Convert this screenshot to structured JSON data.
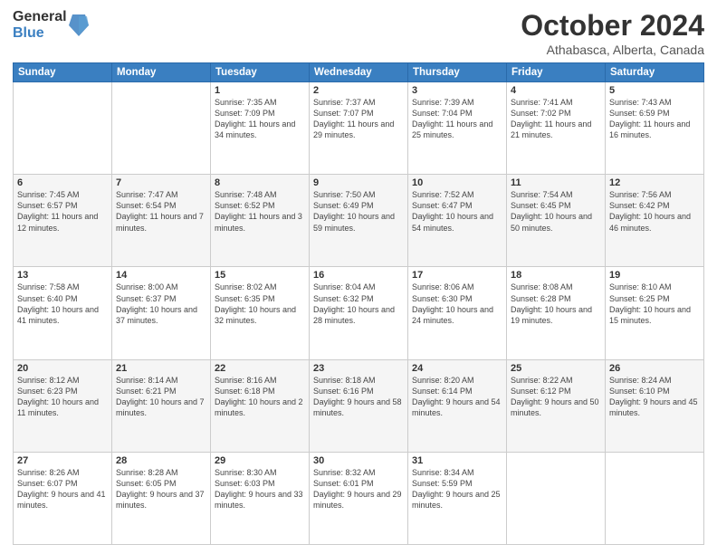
{
  "logo": {
    "general": "General",
    "blue": "Blue"
  },
  "title": "October 2024",
  "location": "Athabasca, Alberta, Canada",
  "weekdays": [
    "Sunday",
    "Monday",
    "Tuesday",
    "Wednesday",
    "Thursday",
    "Friday",
    "Saturday"
  ],
  "weeks": [
    [
      {
        "day": "",
        "sunrise": "",
        "sunset": "",
        "daylight": ""
      },
      {
        "day": "",
        "sunrise": "",
        "sunset": "",
        "daylight": ""
      },
      {
        "day": "1",
        "sunrise": "Sunrise: 7:35 AM",
        "sunset": "Sunset: 7:09 PM",
        "daylight": "Daylight: 11 hours and 34 minutes."
      },
      {
        "day": "2",
        "sunrise": "Sunrise: 7:37 AM",
        "sunset": "Sunset: 7:07 PM",
        "daylight": "Daylight: 11 hours and 29 minutes."
      },
      {
        "day": "3",
        "sunrise": "Sunrise: 7:39 AM",
        "sunset": "Sunset: 7:04 PM",
        "daylight": "Daylight: 11 hours and 25 minutes."
      },
      {
        "day": "4",
        "sunrise": "Sunrise: 7:41 AM",
        "sunset": "Sunset: 7:02 PM",
        "daylight": "Daylight: 11 hours and 21 minutes."
      },
      {
        "day": "5",
        "sunrise": "Sunrise: 7:43 AM",
        "sunset": "Sunset: 6:59 PM",
        "daylight": "Daylight: 11 hours and 16 minutes."
      }
    ],
    [
      {
        "day": "6",
        "sunrise": "Sunrise: 7:45 AM",
        "sunset": "Sunset: 6:57 PM",
        "daylight": "Daylight: 11 hours and 12 minutes."
      },
      {
        "day": "7",
        "sunrise": "Sunrise: 7:47 AM",
        "sunset": "Sunset: 6:54 PM",
        "daylight": "Daylight: 11 hours and 7 minutes."
      },
      {
        "day": "8",
        "sunrise": "Sunrise: 7:48 AM",
        "sunset": "Sunset: 6:52 PM",
        "daylight": "Daylight: 11 hours and 3 minutes."
      },
      {
        "day": "9",
        "sunrise": "Sunrise: 7:50 AM",
        "sunset": "Sunset: 6:49 PM",
        "daylight": "Daylight: 10 hours and 59 minutes."
      },
      {
        "day": "10",
        "sunrise": "Sunrise: 7:52 AM",
        "sunset": "Sunset: 6:47 PM",
        "daylight": "Daylight: 10 hours and 54 minutes."
      },
      {
        "day": "11",
        "sunrise": "Sunrise: 7:54 AM",
        "sunset": "Sunset: 6:45 PM",
        "daylight": "Daylight: 10 hours and 50 minutes."
      },
      {
        "day": "12",
        "sunrise": "Sunrise: 7:56 AM",
        "sunset": "Sunset: 6:42 PM",
        "daylight": "Daylight: 10 hours and 46 minutes."
      }
    ],
    [
      {
        "day": "13",
        "sunrise": "Sunrise: 7:58 AM",
        "sunset": "Sunset: 6:40 PM",
        "daylight": "Daylight: 10 hours and 41 minutes."
      },
      {
        "day": "14",
        "sunrise": "Sunrise: 8:00 AM",
        "sunset": "Sunset: 6:37 PM",
        "daylight": "Daylight: 10 hours and 37 minutes."
      },
      {
        "day": "15",
        "sunrise": "Sunrise: 8:02 AM",
        "sunset": "Sunset: 6:35 PM",
        "daylight": "Daylight: 10 hours and 32 minutes."
      },
      {
        "day": "16",
        "sunrise": "Sunrise: 8:04 AM",
        "sunset": "Sunset: 6:32 PM",
        "daylight": "Daylight: 10 hours and 28 minutes."
      },
      {
        "day": "17",
        "sunrise": "Sunrise: 8:06 AM",
        "sunset": "Sunset: 6:30 PM",
        "daylight": "Daylight: 10 hours and 24 minutes."
      },
      {
        "day": "18",
        "sunrise": "Sunrise: 8:08 AM",
        "sunset": "Sunset: 6:28 PM",
        "daylight": "Daylight: 10 hours and 19 minutes."
      },
      {
        "day": "19",
        "sunrise": "Sunrise: 8:10 AM",
        "sunset": "Sunset: 6:25 PM",
        "daylight": "Daylight: 10 hours and 15 minutes."
      }
    ],
    [
      {
        "day": "20",
        "sunrise": "Sunrise: 8:12 AM",
        "sunset": "Sunset: 6:23 PM",
        "daylight": "Daylight: 10 hours and 11 minutes."
      },
      {
        "day": "21",
        "sunrise": "Sunrise: 8:14 AM",
        "sunset": "Sunset: 6:21 PM",
        "daylight": "Daylight: 10 hours and 7 minutes."
      },
      {
        "day": "22",
        "sunrise": "Sunrise: 8:16 AM",
        "sunset": "Sunset: 6:18 PM",
        "daylight": "Daylight: 10 hours and 2 minutes."
      },
      {
        "day": "23",
        "sunrise": "Sunrise: 8:18 AM",
        "sunset": "Sunset: 6:16 PM",
        "daylight": "Daylight: 9 hours and 58 minutes."
      },
      {
        "day": "24",
        "sunrise": "Sunrise: 8:20 AM",
        "sunset": "Sunset: 6:14 PM",
        "daylight": "Daylight: 9 hours and 54 minutes."
      },
      {
        "day": "25",
        "sunrise": "Sunrise: 8:22 AM",
        "sunset": "Sunset: 6:12 PM",
        "daylight": "Daylight: 9 hours and 50 minutes."
      },
      {
        "day": "26",
        "sunrise": "Sunrise: 8:24 AM",
        "sunset": "Sunset: 6:10 PM",
        "daylight": "Daylight: 9 hours and 45 minutes."
      }
    ],
    [
      {
        "day": "27",
        "sunrise": "Sunrise: 8:26 AM",
        "sunset": "Sunset: 6:07 PM",
        "daylight": "Daylight: 9 hours and 41 minutes."
      },
      {
        "day": "28",
        "sunrise": "Sunrise: 8:28 AM",
        "sunset": "Sunset: 6:05 PM",
        "daylight": "Daylight: 9 hours and 37 minutes."
      },
      {
        "day": "29",
        "sunrise": "Sunrise: 8:30 AM",
        "sunset": "Sunset: 6:03 PM",
        "daylight": "Daylight: 9 hours and 33 minutes."
      },
      {
        "day": "30",
        "sunrise": "Sunrise: 8:32 AM",
        "sunset": "Sunset: 6:01 PM",
        "daylight": "Daylight: 9 hours and 29 minutes."
      },
      {
        "day": "31",
        "sunrise": "Sunrise: 8:34 AM",
        "sunset": "Sunset: 5:59 PM",
        "daylight": "Daylight: 9 hours and 25 minutes."
      },
      {
        "day": "",
        "sunrise": "",
        "sunset": "",
        "daylight": ""
      },
      {
        "day": "",
        "sunrise": "",
        "sunset": "",
        "daylight": ""
      }
    ]
  ]
}
